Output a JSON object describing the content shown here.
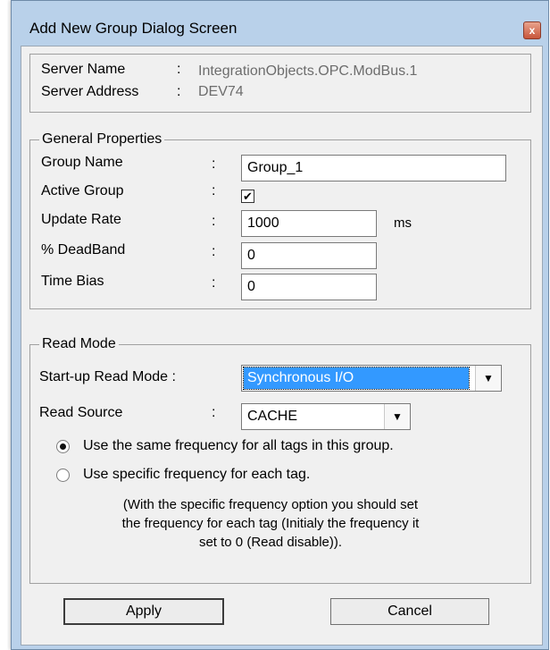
{
  "window": {
    "title": "Add New Group Dialog Screen",
    "close_glyph": "x"
  },
  "server": {
    "name_label": "Server Name",
    "name_colon": ":",
    "name_value": "IntegrationObjects.OPC.ModBus.1",
    "address_label": "Server Address",
    "address_colon": ":",
    "address_value": "DEV74"
  },
  "general": {
    "legend": "General  Properties",
    "group_name_label": "Group Name",
    "group_name_value": "Group_1",
    "active_group_label": "Active Group",
    "active_group_checked": true,
    "active_group_mark": "✔",
    "update_rate_label": "Update Rate",
    "update_rate_value": "1000",
    "update_rate_unit": "ms",
    "deadband_label": "% DeadBand",
    "deadband_value": "0",
    "time_bias_label": "Time Bias",
    "time_bias_value": "0",
    "colon": ":"
  },
  "read_mode": {
    "legend": "Read Mode",
    "startup_label": "Start-up Read Mode :",
    "startup_value": "Synchronous I/O",
    "source_label": "Read Source",
    "source_colon": ":",
    "source_value": "CACHE",
    "option_same": "Use the same frequency for all tags in this group.",
    "option_specific": "Use specific frequency for each tag.",
    "selected_option": "same",
    "note_line1": "(With the specific frequency option you should set",
    "note_line2": "the frequency for each tag (Initialy the frequency it",
    "note_line3": "set to 0 (Read disable)).",
    "dropdown_glyph": "▼"
  },
  "buttons": {
    "apply": "Apply",
    "cancel": "Cancel"
  },
  "colors": {
    "frame": "#b9d1ea",
    "client": "#f0f0f0",
    "selection": "#3399ff",
    "close_button": "#c8553b",
    "disabled_text": "#6d6d6d"
  }
}
